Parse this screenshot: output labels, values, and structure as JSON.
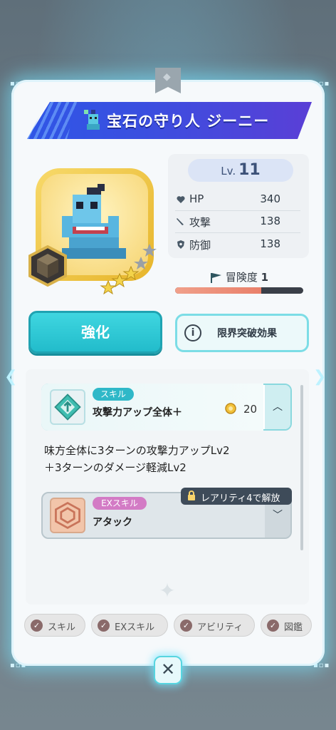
{
  "character": {
    "title": "宝石の守り人 ジーニー",
    "level_label": "Lv.",
    "level": "11",
    "stats": [
      {
        "icon": "heart-icon",
        "label": "HP",
        "value": "340"
      },
      {
        "icon": "sword-icon",
        "label": "攻撃",
        "value": "138"
      },
      {
        "icon": "shield-icon",
        "label": "防御",
        "value": "138"
      }
    ],
    "adventure_label": "冒険度",
    "adventure_value": "1",
    "adventure_progress": 0.67
  },
  "buttons": {
    "enhance": "強化",
    "limit_break": "限界突破効果",
    "info_icon": "i",
    "close": "✕"
  },
  "skill": {
    "tag": "スキル",
    "name": "攻撃力アップ全体＋",
    "cost": "20",
    "chevron": "︿",
    "description_line1": "味方全体に3ターンの攻撃力アップLv2",
    "description_line2": "＋3ターンのダメージ軽減Lv2"
  },
  "ex_skill": {
    "tag": "EXスキル",
    "name": "アタック",
    "chevron": "﹀",
    "lock_text": "レアリティ4で解放"
  },
  "tabs": [
    {
      "label": "スキル"
    },
    {
      "label": "EXスキル"
    },
    {
      "label": "アビリティ"
    },
    {
      "label": "図鑑"
    }
  ],
  "colors": {
    "accent_cyan": "#22bccb",
    "ribbon_blue": "#2f56e6",
    "gold": "#e7b52b",
    "ex_pink": "#d37bc5"
  }
}
